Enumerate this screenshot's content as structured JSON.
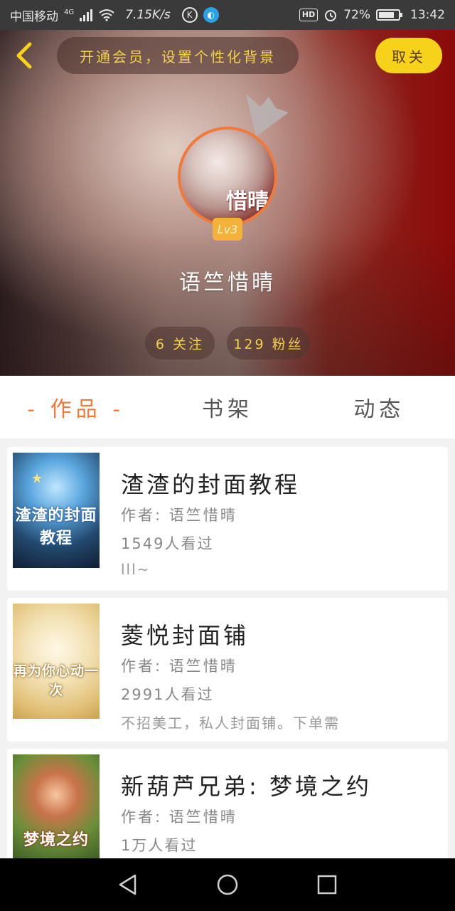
{
  "status_bar": {
    "carrier": "中国移动",
    "network": "4G",
    "speed": "7.15K/s",
    "hd": "HD",
    "battery": "72%",
    "time": "13:42",
    "icons": [
      "signal-icon",
      "wifi-icon",
      "k-app-icon",
      "browser-app-icon",
      "alarm-icon",
      "battery-icon"
    ]
  },
  "header": {
    "vip_banner": "开通会员，设置个性化背景",
    "follow_button": "取关",
    "username": "语竺惜晴",
    "level": "Lv3",
    "avatar_text": "惜晴",
    "following": "6 关注",
    "fans": "129 粉丝"
  },
  "tabs": [
    {
      "label": "- 作品 -",
      "active": true
    },
    {
      "label": "书架",
      "active": false
    },
    {
      "label": "动态",
      "active": false
    }
  ],
  "works": [
    {
      "title": "渣渣的封面教程",
      "author": "作者: 语竺惜晴",
      "views": "1549人看过",
      "desc": "lll~",
      "cover_text": "渣渣的封面教程"
    },
    {
      "title": "菱悦封面铺",
      "author": "作者: 语竺惜晴",
      "views": "2991人看过",
      "desc": "不招美工，私人封面铺。下单需",
      "cover_text": "再为你心动一次"
    },
    {
      "title": "新葫芦兄弟: 梦境之约",
      "author": "作者: 语竺惜晴",
      "views": "1万人看过",
      "desc": "",
      "cover_text": "梦境之约"
    }
  ],
  "colors": {
    "accent": "#f07a3a",
    "vip_text": "#f2d24a",
    "follow_button_bg": "#f7d21a"
  }
}
